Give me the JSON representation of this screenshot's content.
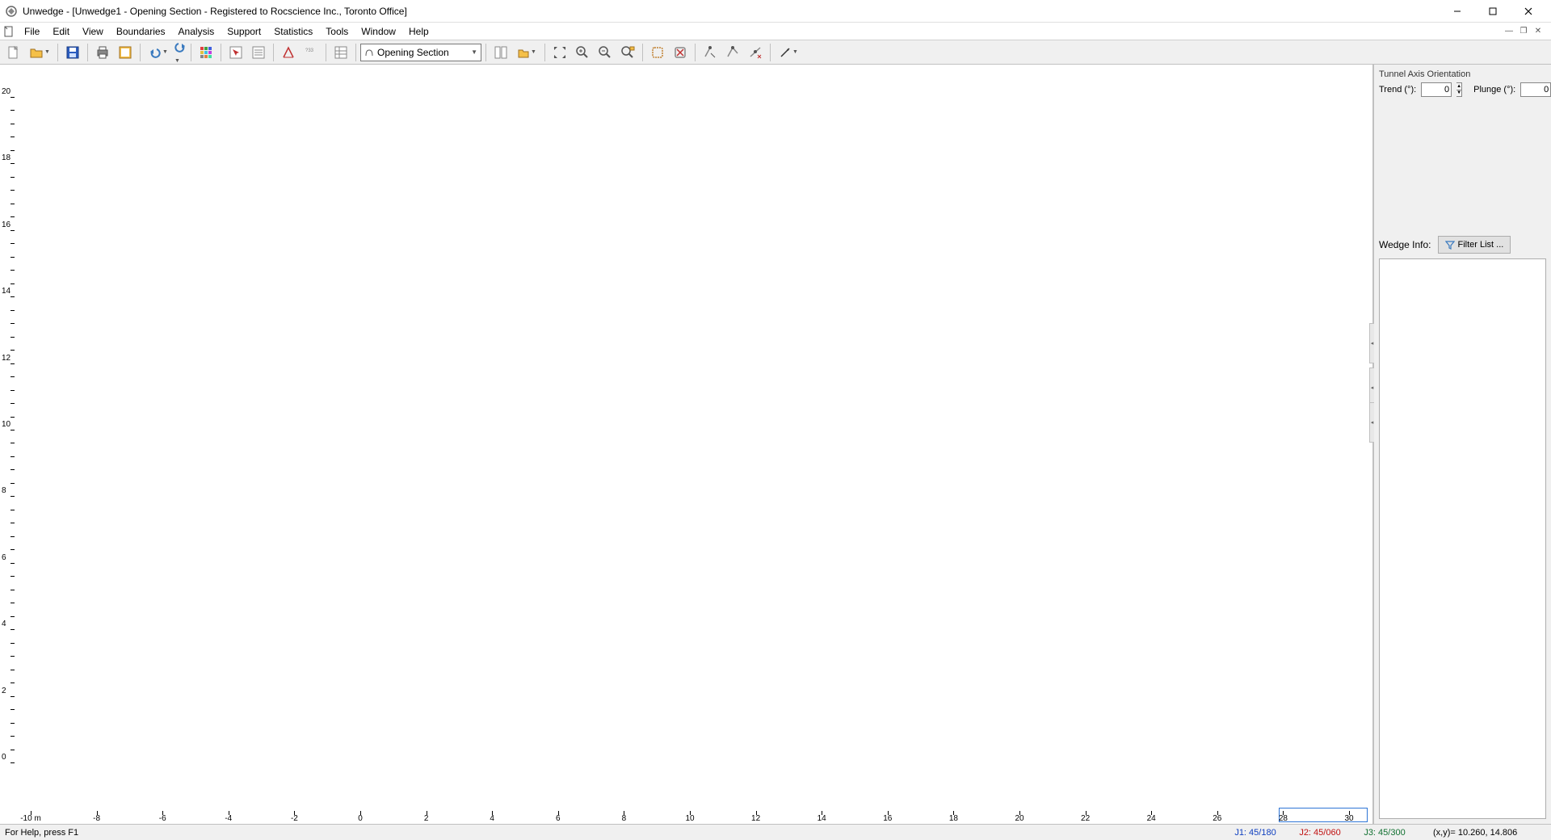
{
  "title": "Unwedge - [Unwedge1 - Opening Section - Registered to Rocscience Inc., Toronto Office]",
  "menu": [
    "File",
    "Edit",
    "View",
    "Boundaries",
    "Analysis",
    "Support",
    "Statistics",
    "Tools",
    "Window",
    "Help"
  ],
  "toolbar": {
    "view_combo": "Opening Section"
  },
  "sidepanel": {
    "group_title": "Tunnel Axis Orientation",
    "trend_label": "Trend (°):",
    "trend_value": "0",
    "plunge_label": "Plunge (°):",
    "plunge_value": "0",
    "wedge_info_label": "Wedge Info:",
    "filter_btn": "Filter List ..."
  },
  "statusbar": {
    "help": "For Help, press F1",
    "j1": "J1: 45/180",
    "j2": "J2: 45/060",
    "j3": "J3: 45/300",
    "xy": "(x,y)= 10.260, 14.806"
  },
  "ruler_x": {
    "min": -10,
    "max": 30,
    "step": 2,
    "unit_label": "-10 m"
  },
  "ruler_y": {
    "min": 0,
    "max": 20,
    "step": 2
  }
}
